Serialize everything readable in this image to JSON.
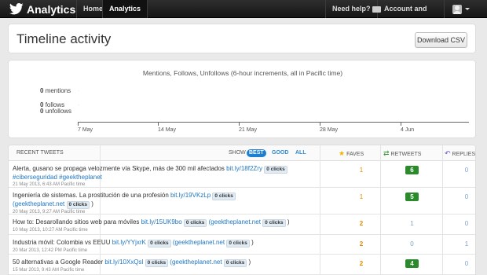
{
  "topbar": {
    "brand": "Analytics",
    "nav_home": "Home",
    "nav_analytics": "Analytics",
    "nav_help": "Need help?",
    "nav_account": "Account and billing"
  },
  "header": {
    "title": "Timeline activity",
    "download_label": "Download CSV"
  },
  "chart": {
    "title": "Mentions, Follows, Unfollows (6-hour increments, all in Pacific time)",
    "series": [
      {
        "count": "0",
        "name": "mentions"
      },
      {
        "count": "0",
        "name": "follows"
      },
      {
        "count": "0",
        "name": "unfollows"
      }
    ],
    "x_ticks": [
      "7 May",
      "14 May",
      "21 May",
      "28 May",
      "4 Jun"
    ]
  },
  "table": {
    "headers": {
      "recent": "RECENT TWEETS",
      "show": "SHOW",
      "filters": [
        "BEST",
        "GOOD",
        "ALL"
      ],
      "faves": "FAVES",
      "retweets": "RETWEETS",
      "replies": "REPLIES"
    },
    "rows": [
      {
        "text": "Alerta, gusano se propaga velozmente vía Skype, más de 300 mil afectados",
        "link": "bit.ly/18f2Zry",
        "clicks": "0 clicks",
        "tags": "#ciberseguridad #geektheplanet",
        "meta": "21 May 2013, 6:43 AM Pacific time",
        "faves": "1",
        "retweets": "6",
        "replies": "0"
      },
      {
        "text": "Ingeniería de sistemas. La prostitución de una profesión",
        "link": "bit.ly/19VKzLp",
        "clicks": "0 clicks",
        "handle": "(geektheplanet.net",
        "handle_clicks": "0 clicks",
        "close": ")",
        "meta": "20 May 2013, 9:27 AM Pacific time",
        "faves": "1",
        "retweets": "5",
        "replies": "0"
      },
      {
        "text": "How to: Desarollando sitios web para móviles",
        "link": "bit.ly/15UK9bo",
        "clicks": "0 clicks",
        "handle": "(geektheplanet.net",
        "handle_clicks": "0 clicks",
        "close": ")",
        "meta": "10 May 2013, 10:27 AM Pacific time",
        "faves": "2",
        "retweets": "1",
        "replies": "0"
      },
      {
        "text": "Industria móvil: Colombia vs EEUU",
        "link": "bit.ly/YYjxrK",
        "clicks": "0 clicks",
        "handle": "(geektheplanet.net",
        "handle_clicks": "0 clicks",
        "close": ")",
        "meta": "20 Mar 2013, 12:42 PM Pacific time",
        "faves": "2",
        "retweets": "0",
        "replies": "1"
      },
      {
        "text": "50 alternativas a Google Reader",
        "link": "bit.ly/10XxQsl",
        "clicks": "0 clicks",
        "handle": "(geektheplanet.net",
        "handle_clicks": "0 clicks",
        "close": ")",
        "meta": "15 Mar 2013, 9:43 AM Pacific time",
        "faves": "2",
        "retweets": "4",
        "replies": "0"
      }
    ]
  },
  "colors": {
    "accent": "#1d7fd0",
    "retweet_badge": "#2b8a2b",
    "fave": "#e38b00"
  }
}
